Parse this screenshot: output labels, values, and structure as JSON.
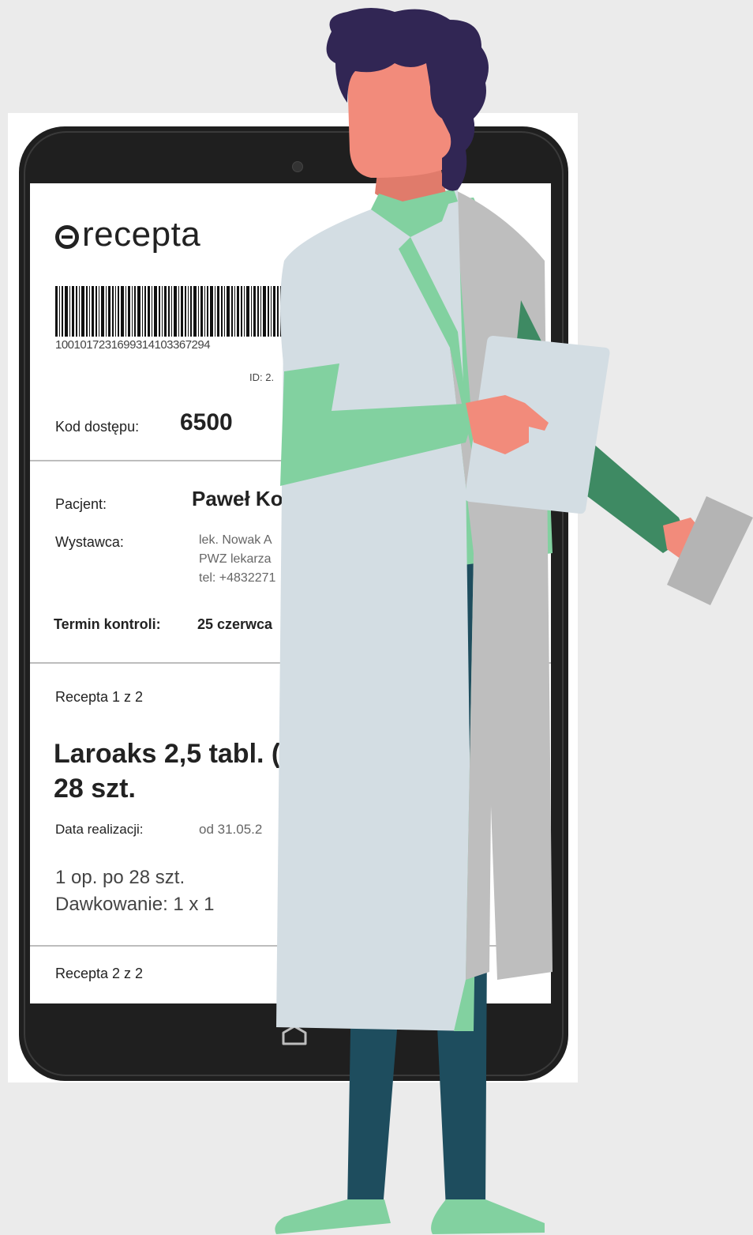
{
  "colors": {
    "background": "#ebebeb",
    "tablet": "#1f1f1f",
    "skin": "#f28b7b",
    "hair": "#312654",
    "coat": "#d3dde3",
    "shirt": "#82d1a0",
    "pants": "#1e4d5e",
    "shoes": "#82d1a0"
  },
  "app": {
    "logo_text": "recepta",
    "barcode_number": "1001017231699314103367294",
    "id_label": "ID: 2.",
    "access_code_label": "Kod dostępu:",
    "access_code_value": "6500"
  },
  "patient": {
    "patient_label": "Pacjent:",
    "patient_name": "Paweł Ko",
    "issuer_label": "Wystawca:",
    "issuer_lines": [
      "lek. Nowak A",
      "PWZ lekarza",
      "tel: +4832271"
    ],
    "control_label": "Termin kontroli:",
    "control_value": "25 czerwca"
  },
  "prescription1": {
    "header": "Recepta 1 z 2",
    "drug_line1": "Laroaks 2,5 tabl. (",
    "drug_line2": "28 szt.",
    "realization_label": "Data realizacji:",
    "realization_value": "od 31.05.2",
    "pack_line": "1 op. po 28 szt.",
    "dosage_line": "Dawkowanie: 1 x 1"
  },
  "prescription2": {
    "header": "Recepta 2 z 2"
  },
  "icons": {
    "home": "home-icon",
    "logo": "e-logo-icon"
  }
}
